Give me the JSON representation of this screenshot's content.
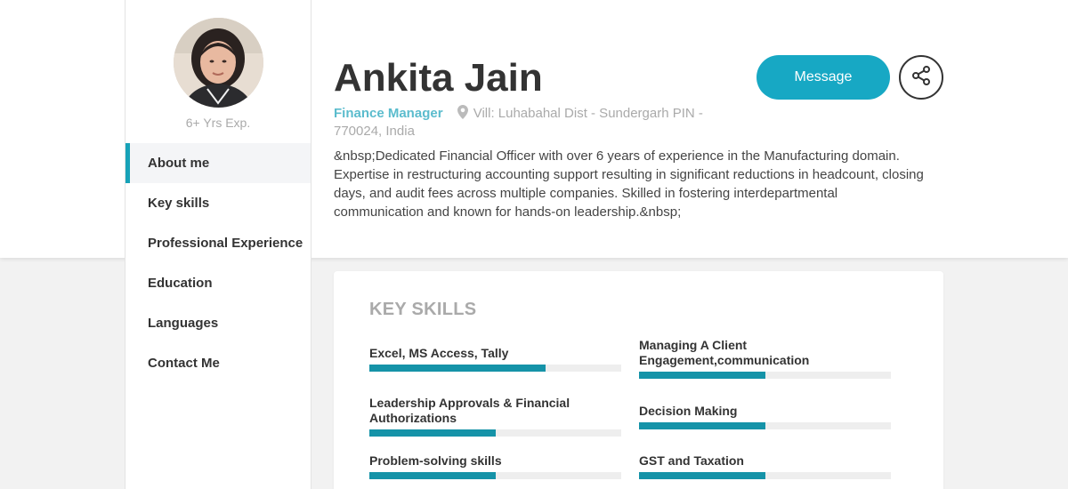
{
  "profile": {
    "name": "Ankita Jain",
    "experience": "6+ Yrs Exp.",
    "title": "Finance Manager",
    "location": "Vill: Luhabahal Dist - Sundergarh PIN - 770024, India",
    "bio": "&nbsp;Dedicated Financial Officer with over 6 years of experience in the Manufacturing domain. Expertise in restructuring accounting support resulting in significant reductions in headcount, closing days, and audit fees across multiple companies. Skilled in fostering interdepartmental communication and known for hands-on leadership.&nbsp;"
  },
  "actions": {
    "message_label": "Message",
    "share_icon": "share-icon"
  },
  "nav": {
    "items": [
      {
        "label": "About me",
        "active": true
      },
      {
        "label": "Key skills",
        "active": false
      },
      {
        "label": "Professional Experience",
        "active": false
      },
      {
        "label": "Education",
        "active": false
      },
      {
        "label": "Languages",
        "active": false
      },
      {
        "label": "Contact Me",
        "active": false
      }
    ]
  },
  "skills": {
    "heading": "KEY SKILLS",
    "items": [
      {
        "label": "Excel, MS Access, Tally",
        "level": 0.7
      },
      {
        "label": "Managing A Client Engagement,communication",
        "level": 0.5
      },
      {
        "label": "Leadership Approvals & Financial Authorizations",
        "level": 0.5
      },
      {
        "label": "Decision Making",
        "level": 0.5
      },
      {
        "label": "Problem-solving skills",
        "level": 0.5
      },
      {
        "label": "GST and Taxation",
        "level": 0.5
      }
    ]
  },
  "colors": {
    "accent": "#17a8c4",
    "skill_bar": "#1593a8",
    "title": "#5bbccd"
  }
}
